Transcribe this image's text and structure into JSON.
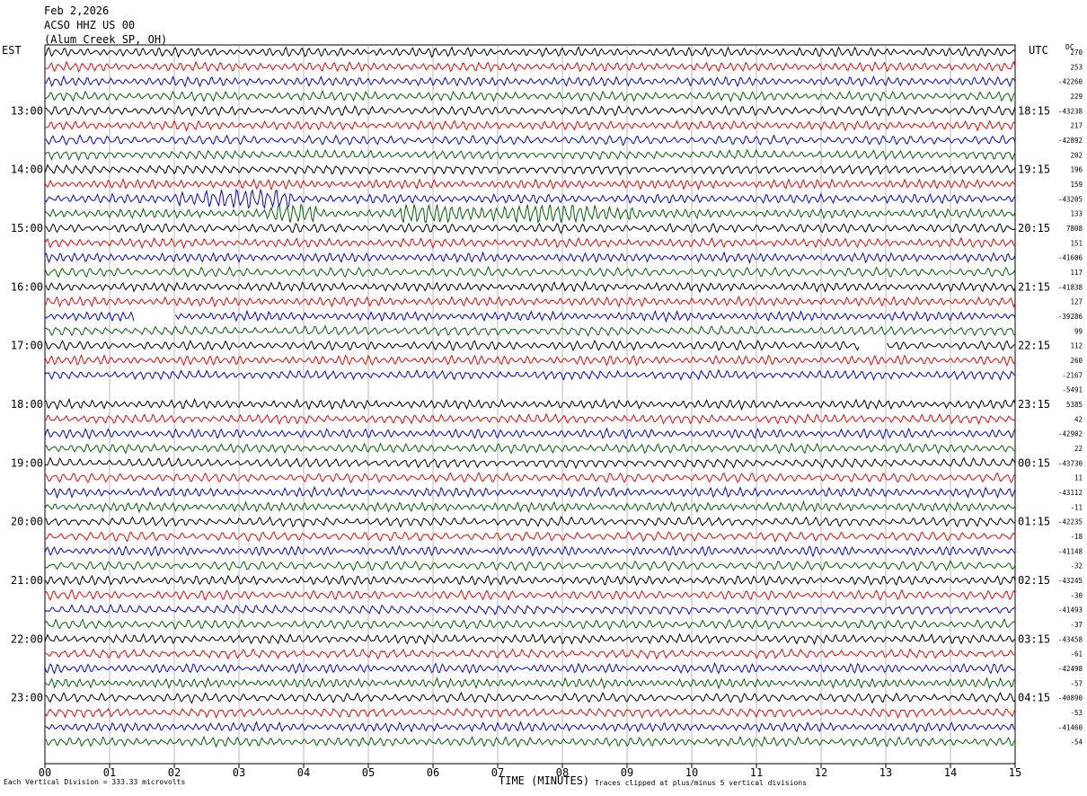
{
  "header": {
    "date": "Feb 2,2026",
    "station": "ACSO HHZ US 00",
    "location": "(Alum Creek SP, OH)"
  },
  "left_timezone": "EST",
  "right_timezone": "UTC",
  "dc_label": "DC",
  "footer": {
    "scale": "Each Vertical Division =  333.33 microvolts",
    "clip_note": "Traces clipped at plus/minus 5 vertical divisions"
  },
  "colors": {
    "black": "#000000",
    "red": "#ff0000",
    "blue": "#0000ff",
    "green": "#006400",
    "grid": "#888888"
  },
  "chart_data": {
    "type": "line",
    "title": "ACSO HHZ US 00",
    "xlabel": "TIME (MINUTES)",
    "ylabel": "",
    "xlim": [
      0,
      15
    ],
    "x_ticks": [
      "00",
      "01",
      "02",
      "03",
      "04",
      "05",
      "06",
      "07",
      "08",
      "09",
      "10",
      "11",
      "12",
      "13",
      "14",
      "15"
    ],
    "trace_interval_minutes": 15,
    "trace_color_cycle": [
      "black",
      "red",
      "blue",
      "green"
    ],
    "left_hour_labels": [
      "13:00",
      "14:00",
      "15:00",
      "16:00",
      "17:00",
      "18:00",
      "19:00",
      "20:00",
      "21:00",
      "22:00",
      "23:00"
    ],
    "right_hour_labels": [
      "18:15",
      "19:15",
      "20:15",
      "21:15",
      "22:15",
      "23:15",
      "00:15",
      "01:15",
      "02:15",
      "03:15",
      "04:15"
    ],
    "trace_offsets": [
      "270",
      "253",
      "-42260",
      "229",
      "-43238",
      "217",
      "-42892",
      "202",
      "196",
      "159",
      "-43205",
      "133",
      "7808",
      "151",
      "-41606",
      "117",
      "-41838",
      "127",
      "-39286",
      "99",
      "112",
      "260",
      "-2167",
      "-5491",
      "5385",
      "42",
      "-42902",
      "22",
      "-43730",
      "11",
      "-43112",
      "-11",
      "-42235",
      "-18",
      "-41148",
      "-32",
      "-43245",
      "-30",
      "-41493",
      "-37",
      "-43458",
      "-61",
      "-42498",
      "-57",
      "-40890",
      "-53",
      "-41460",
      "-54"
    ],
    "gaps": [
      {
        "trace": 18,
        "start_min": 1.38,
        "end_min": 2.0
      },
      {
        "trace": 20,
        "start_min": 12.6,
        "end_min": 13.0
      },
      {
        "trace": 23,
        "start_min": 0.0,
        "end_min": 15.0
      }
    ],
    "events": [
      {
        "trace": 10,
        "start_min": 2.0,
        "end_min": 3.8,
        "note": "elevated amplitude"
      },
      {
        "trace": 11,
        "start_min": 3.5,
        "end_min": 4.2,
        "note": "elevated amplitude"
      },
      {
        "trace": 11,
        "start_min": 5.5,
        "end_min": 9.2,
        "note": "elevated amplitude"
      }
    ],
    "grid": true
  }
}
